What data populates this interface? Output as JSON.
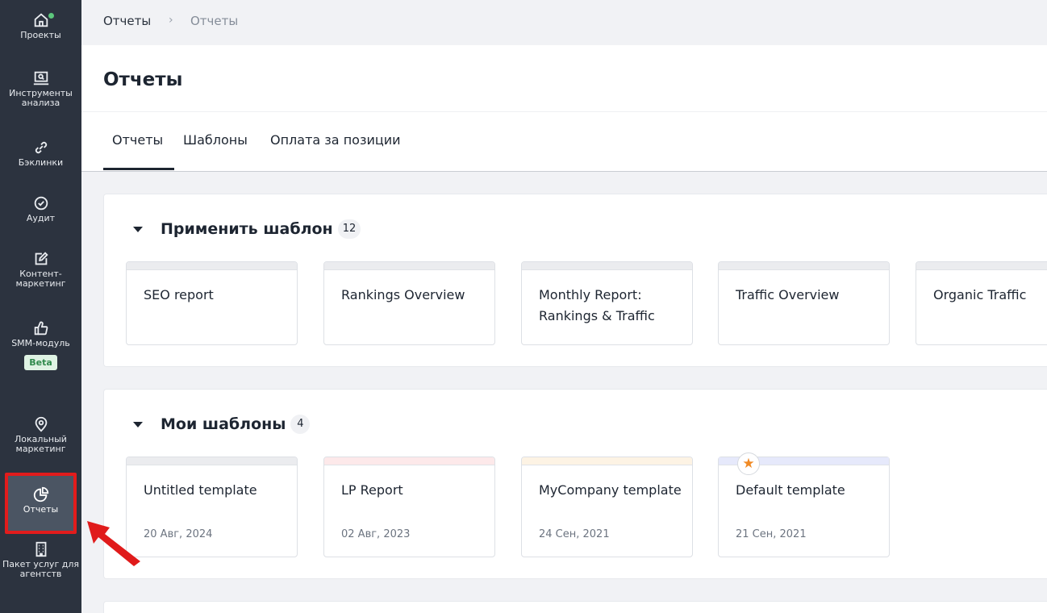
{
  "sidebar": {
    "items": [
      {
        "label": "Проекты",
        "icon": "home-icon"
      },
      {
        "label": "Инструменты анализа",
        "icon": "magnifier-screen-icon"
      },
      {
        "label": "Бэклинки",
        "icon": "link-icon"
      },
      {
        "label": "Аудит",
        "icon": "check-circle-icon"
      },
      {
        "label": "Контент-маркетинг",
        "icon": "edit-icon"
      },
      {
        "label": "SMM-модуль",
        "icon": "thumbs-up-icon",
        "badge": "Beta"
      },
      {
        "label": "Локальный маркетинг",
        "icon": "location-pin-icon"
      },
      {
        "label": "Отчеты",
        "icon": "pie-chart-icon",
        "active": true
      },
      {
        "label": "Пакет услуг для агентств",
        "icon": "building-icon"
      }
    ]
  },
  "breadcrumb": {
    "root": "Отчеты",
    "current": "Отчеты"
  },
  "page": {
    "title": "Отчеты"
  },
  "tabs": [
    {
      "label": "Отчеты",
      "active": true
    },
    {
      "label": "Шаблоны"
    },
    {
      "label": "Оплата за позиции"
    }
  ],
  "apply_template": {
    "title": "Применить шаблон",
    "count": "12",
    "cards": [
      {
        "title": "SEO report"
      },
      {
        "title": "Rankings Overview"
      },
      {
        "title": "Monthly Report: Rankings & Traffic"
      },
      {
        "title": "Traffic Overview"
      },
      {
        "title": "Organic Traffic"
      }
    ]
  },
  "my_templates": {
    "title": "Мои шаблоны",
    "count": "4",
    "cards": [
      {
        "title": "Untitled template",
        "date": "20 Авг, 2024",
        "color": "#ebecef"
      },
      {
        "title": "LP Report",
        "date": "02 Авг, 2023",
        "color": "#fde9ea"
      },
      {
        "title": "MyCompany template",
        "date": "24 Сен, 2021",
        "color": "#fdf3e4"
      },
      {
        "title": "Default template",
        "date": "21 Сен, 2021",
        "color": "#e6e9fb",
        "starred": true
      }
    ]
  },
  "colors": {
    "sidebar_bg": "#2c333f",
    "highlight": "#e21c1c",
    "accent_star": "#f08a24",
    "beta_badge": "#dff3e4"
  }
}
